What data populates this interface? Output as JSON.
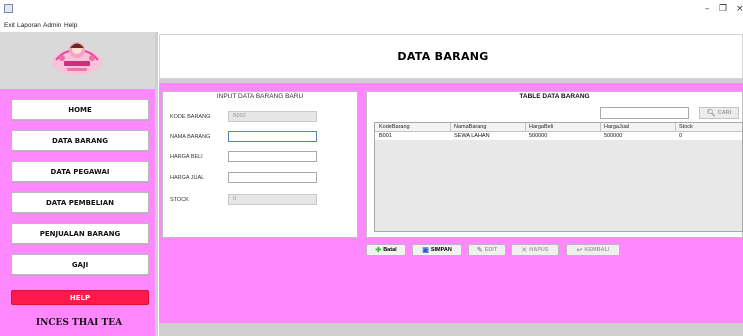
{
  "window": {
    "minimize": "–",
    "maximize": "❐",
    "close": "×"
  },
  "menu": [
    "Exit",
    "Laporan",
    "Admin",
    "Help"
  ],
  "sidebar": {
    "items": [
      {
        "label": "HOME"
      },
      {
        "label": "DATA BARANG"
      },
      {
        "label": "DATA PEGAWAI"
      },
      {
        "label": "DATA PEMBELIAN"
      },
      {
        "label": "PENJUALAN BARANG"
      },
      {
        "label": "GAJI"
      }
    ],
    "help": "HELP",
    "brand": "INCES THAI TEA"
  },
  "header": {
    "title": "DATA BARANG"
  },
  "input_panel": {
    "title": "INPUT DATA BARANG BARU",
    "fields": [
      {
        "label": "KODE BARANG",
        "value": "B002"
      },
      {
        "label": "NAMA BARANG",
        "value": ""
      },
      {
        "label": "HARGA BELI",
        "value": ""
      },
      {
        "label": "HARGA JUAL",
        "value": ""
      },
      {
        "label": "STOCK",
        "value": "0"
      }
    ]
  },
  "table_panel": {
    "title": "TABLE DATA BARANG",
    "search_value": "",
    "search_button": "CARI",
    "columns": [
      "KodeBarang",
      "NamaBarang",
      "HargaBeli",
      "HargaJual",
      "Stock"
    ],
    "rows": [
      [
        "B001",
        "SEWA LAHAN",
        "500000",
        "500000",
        "0"
      ]
    ]
  },
  "actions": {
    "batal": "Batal",
    "simpan": "SIMPAN",
    "edit": "EDIT",
    "hapus": "HAPUS",
    "kembali": "KEMBALI"
  },
  "colors": {
    "pink": "#ff88ff",
    "help_red": "#ff1a4a",
    "batal_icon": "#3cb043",
    "simpan_icon": "#2a5bd7"
  },
  "icons": [
    "app-icon",
    "logo",
    "search-icon",
    "add-icon",
    "save-icon",
    "edit-icon",
    "delete-icon",
    "back-icon"
  ]
}
